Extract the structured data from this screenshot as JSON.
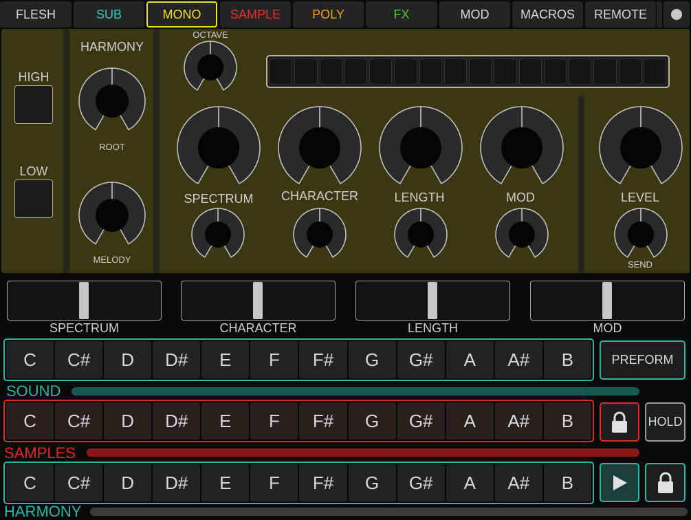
{
  "tabs": [
    {
      "label": "FLESH",
      "color": "#d8d8d8"
    },
    {
      "label": "SUB",
      "color": "#3cc8b8"
    },
    {
      "label": "MONO",
      "color": "#f0e020"
    },
    {
      "label": "SAMPLE",
      "color": "#e8302a"
    },
    {
      "label": "POLY",
      "color": "#f0a020"
    },
    {
      "label": "FX",
      "color": "#50c828"
    },
    {
      "label": "MOD",
      "color": "#d8d8d8"
    },
    {
      "label": "MACROS",
      "color": "#d8d8d8"
    },
    {
      "label": "REMOTE",
      "color": "#d8d8d8"
    }
  ],
  "active_tab": "MONO",
  "panel": {
    "high": "HIGH",
    "low": "LOW",
    "harmony": "HARMONY",
    "root": "ROOT",
    "melody": "MELODY",
    "octave": "OCTAVE",
    "spectrum": "SPECTRUM",
    "character": "CHARACTER",
    "length": "LENGTH",
    "mod": "MOD",
    "level": "LEVEL",
    "send": "SEND"
  },
  "step_count": 16,
  "sliders": [
    {
      "label": "SPECTRUM",
      "value": 0.5
    },
    {
      "label": "CHARACTER",
      "value": 0.5
    },
    {
      "label": "LENGTH",
      "value": 0.5
    },
    {
      "label": "MOD",
      "value": 0.5
    }
  ],
  "notes": [
    "C",
    "C#",
    "D",
    "D#",
    "E",
    "F",
    "F#",
    "G",
    "G#",
    "A",
    "A#",
    "B"
  ],
  "rows": {
    "sound": {
      "label": "SOUND",
      "color": "#28b8a8"
    },
    "samples": {
      "label": "SAMPLES",
      "color": "#e02a28"
    },
    "harmony": {
      "label": "HARMONY",
      "color": "#28b8a8"
    }
  },
  "buttons": {
    "preform": "PREFORM",
    "hold": "HOLD"
  },
  "icons": {
    "lock": "lock-icon",
    "play": "play-icon",
    "dot": "circle-icon"
  }
}
